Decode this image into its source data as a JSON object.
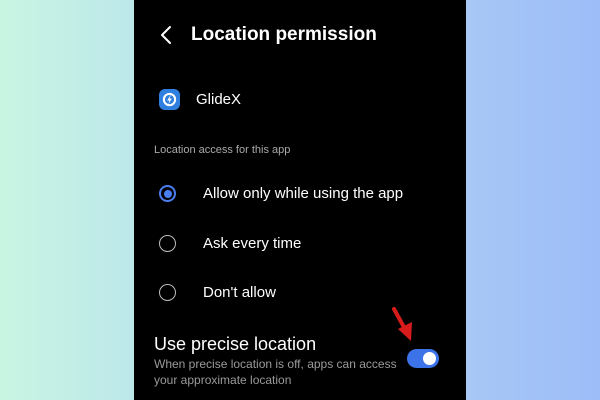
{
  "colors": {
    "screen_bg": "#000000",
    "accent": "#4a7ef0",
    "toggle_on": "#3c73e9",
    "annotation_arrow": "#d81c1c"
  },
  "header": {
    "back_icon": "chevron-left-icon",
    "title": "Location permission"
  },
  "app": {
    "icon": "glidex-app-icon",
    "name": "GlideX"
  },
  "location_access": {
    "header": "Location access for this app",
    "options": [
      {
        "label": "Allow only while using the app",
        "selected": true
      },
      {
        "label": "Ask every time",
        "selected": false
      },
      {
        "label": "Don't allow",
        "selected": false
      }
    ]
  },
  "precise_location": {
    "title": "Use precise location",
    "description": "When precise location is off, apps can access your approximate location",
    "enabled": true
  }
}
